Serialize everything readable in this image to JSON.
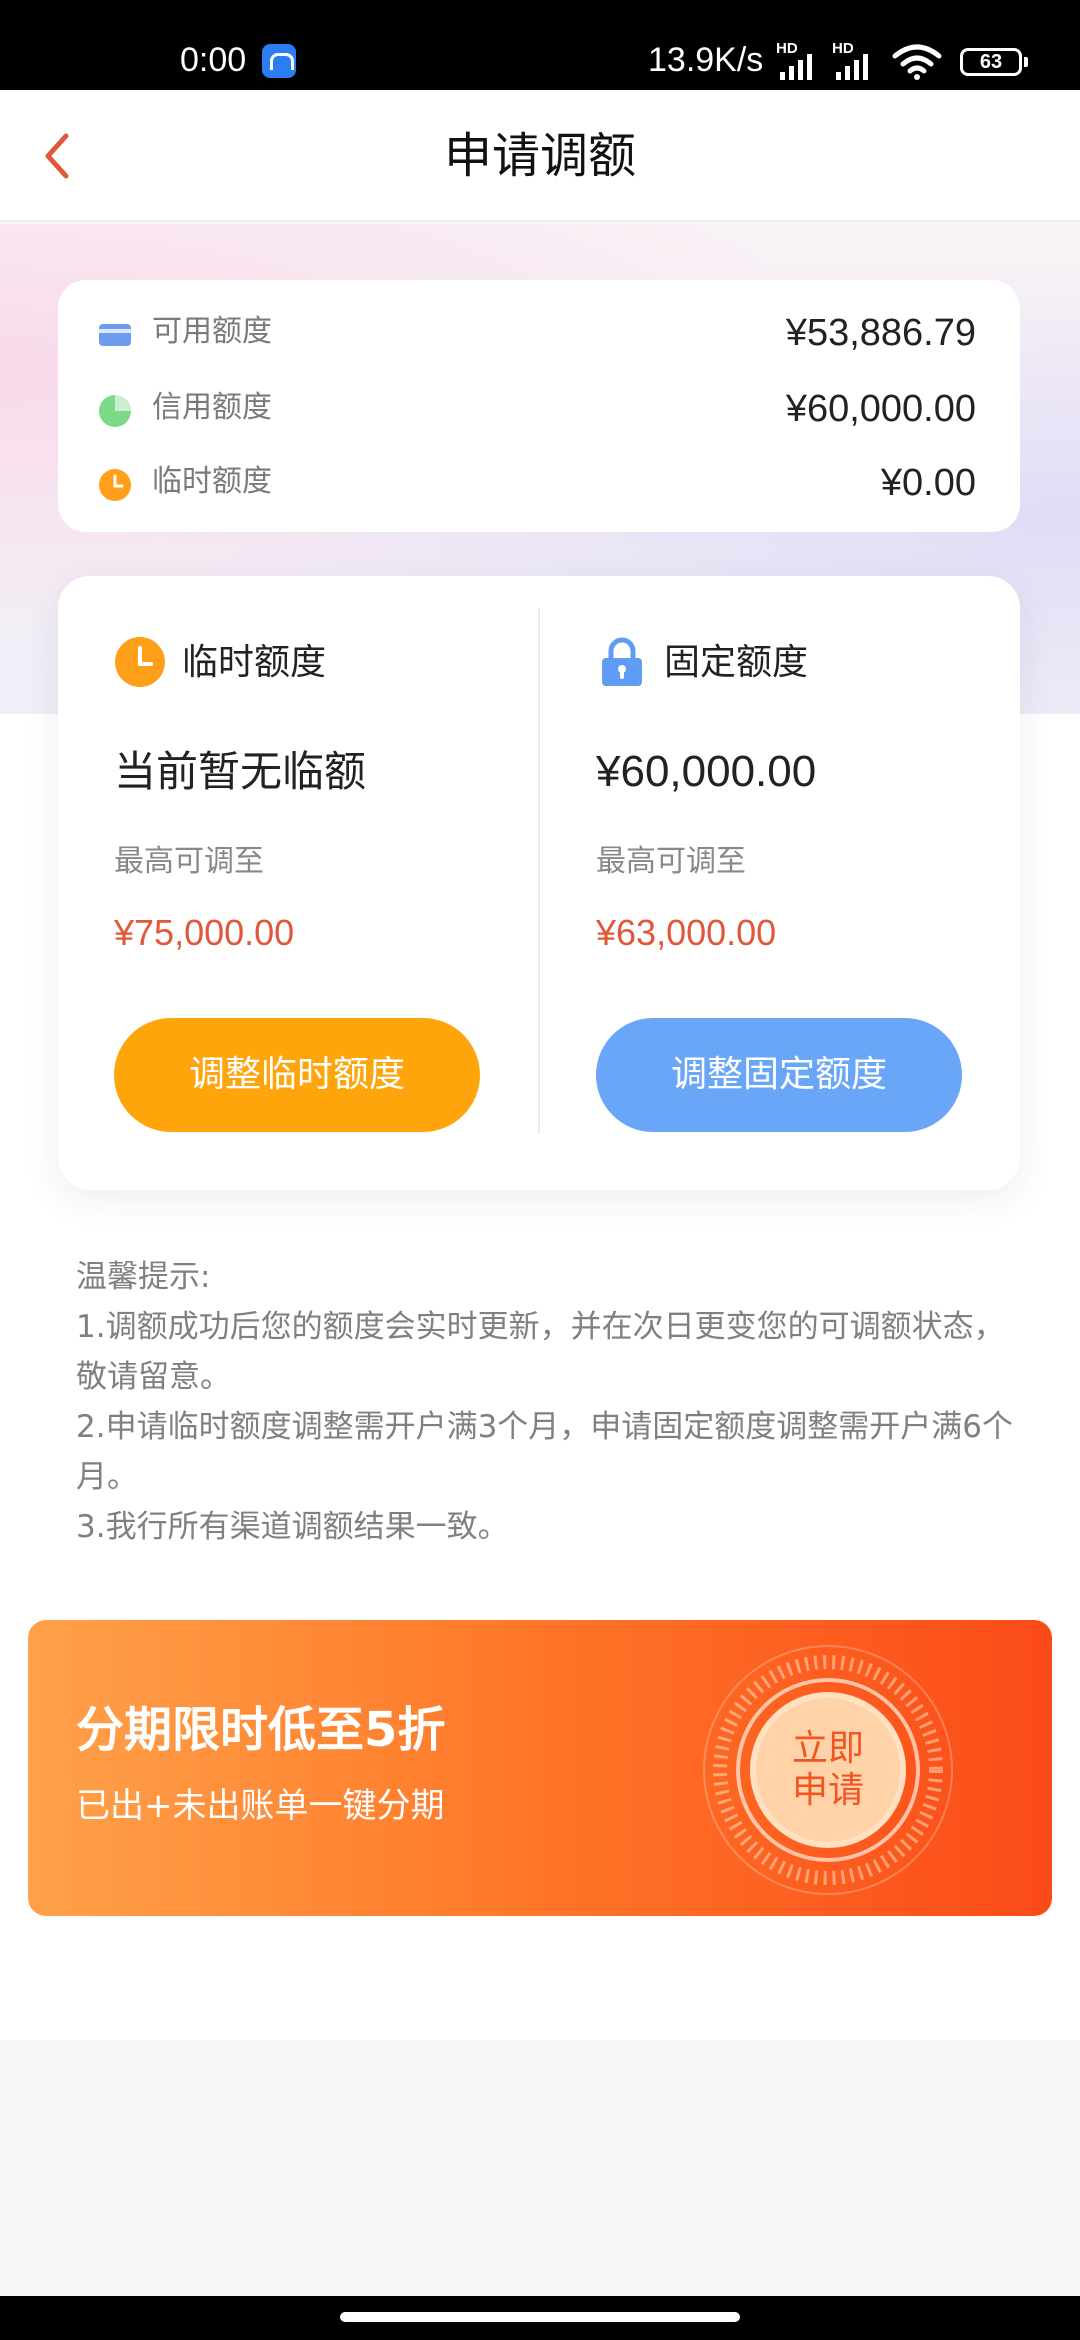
{
  "status_bar": {
    "time": "0:00",
    "net_speed": "13.9K/s",
    "signal_1_label": "HD",
    "signal_2_label": "HD",
    "battery": "63"
  },
  "nav": {
    "title": "申请调额"
  },
  "summary": {
    "rows": [
      {
        "label": "可用额度",
        "value": "¥53,886.79",
        "icon": "card-icon",
        "color": "#6b9cf0"
      },
      {
        "label": "信用额度",
        "value": "¥60,000.00",
        "icon": "pie-chart-icon",
        "color": "#7cd98a"
      },
      {
        "label": "临时额度",
        "value": "¥0.00",
        "icon": "clock-icon",
        "color": "#ff9f1a"
      }
    ]
  },
  "temp_limit": {
    "title": "临时额度",
    "current": "当前暂无临额",
    "max_label": "最高可调至",
    "max_value": "¥75,000.00",
    "button": "调整临时额度"
  },
  "fixed_limit": {
    "title": "固定额度",
    "current": "¥60,000.00",
    "max_label": "最高可调至",
    "max_value": "¥63,000.00",
    "button": "调整固定额度"
  },
  "tips": {
    "heading": "温馨提示:",
    "line1": "1.调额成功后您的额度会实时更新，并在次日更变您的可调额状态，敬请留意。",
    "line2": "2.申请临时额度调整需开户满3个月，申请固定额度调整需开户满6个月。",
    "line3": "3.我行所有渠道调额结果一致。"
  },
  "banner": {
    "title": "分期限时低至5折",
    "subtitle": "已出+未出账单一键分期",
    "badge_line1": "立即",
    "badge_line2": "申请"
  },
  "colors": {
    "accent_red": "#e2563a",
    "orange_button": "#ffa50c",
    "blue_button": "#6aa6f8",
    "back_arrow": "#e0573b"
  }
}
